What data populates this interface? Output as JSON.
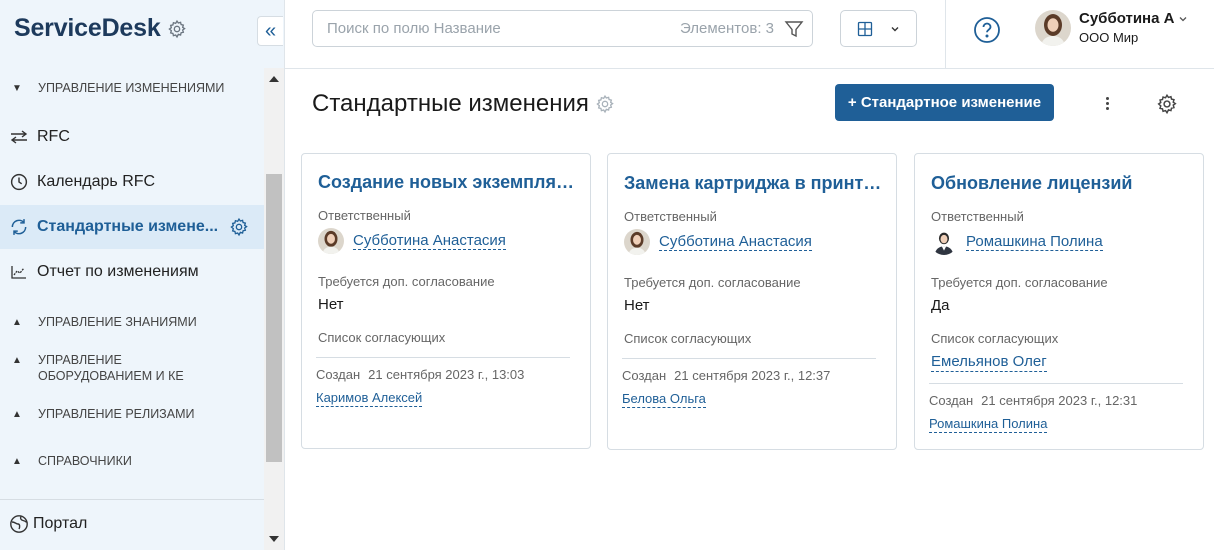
{
  "brand": {
    "title": "ServiceDesk"
  },
  "sidebar": {
    "sections": [
      {
        "label": "Управление изменениями",
        "expanded": true
      },
      {
        "label": "Управление знаниями",
        "expanded": false
      },
      {
        "label": "Управление оборудованием и КЕ",
        "expanded": false
      },
      {
        "label": "Управление релизами",
        "expanded": false
      },
      {
        "label": "Справочники",
        "expanded": false
      }
    ],
    "items": [
      {
        "label": "RFC",
        "icon": "arrows-exchange-icon"
      },
      {
        "label": "Календарь RFC",
        "icon": "clock-icon"
      },
      {
        "label": "Стандартные измене...",
        "icon": "refresh-icon",
        "active": true
      },
      {
        "label": "Отчет по изменениям",
        "icon": "line-chart-icon"
      }
    ],
    "portal": {
      "label": "Портал",
      "icon": "globe-icon"
    }
  },
  "header": {
    "search": {
      "placeholder": "Поиск по полю Название",
      "count_label": "Элементов: 3"
    },
    "user": {
      "name": "Субботина А",
      "org": "ООО Мир"
    }
  },
  "main": {
    "title": "Стандартные изменения",
    "add_button": "+ Стандартное изменение",
    "cards": [
      {
        "title": "Создание новых экземпляров...",
        "responsible_label": "Ответственный",
        "responsible": "Субботина Анастасия",
        "approval_label": "Требуется доп. согласование",
        "approval": "Нет",
        "approvers_label": "Список согласующих",
        "approvers": "",
        "created_label": "Создан",
        "created_at": "21 сентября 2023 г., 13:03",
        "author": "Каримов Алексей"
      },
      {
        "title": "Замена картриджа в принтере",
        "responsible_label": "Ответственный",
        "responsible": "Субботина Анастасия",
        "approval_label": "Требуется доп. согласование",
        "approval": "Нет",
        "approvers_label": "Список согласующих",
        "approvers": "",
        "created_label": "Создан",
        "created_at": "21 сентября 2023 г., 12:37",
        "author": "Белова Ольга"
      },
      {
        "title": "Обновление лицензий",
        "responsible_label": "Ответственный",
        "responsible": "Ромашкина Полина",
        "approval_label": "Требуется доп. согласование",
        "approval": "Да",
        "approvers_label": "Список согласующих",
        "approvers": "Емельянов Олег",
        "created_label": "Создан",
        "created_at": "21 сентября 2023 г., 12:31",
        "author": "Ромашкина Полина"
      }
    ]
  },
  "colors": {
    "accent": "#1f5f97",
    "brand": "#1d3a5c",
    "sidebar_bg": "#eef5fb",
    "active_bg": "#dbeaf7"
  }
}
